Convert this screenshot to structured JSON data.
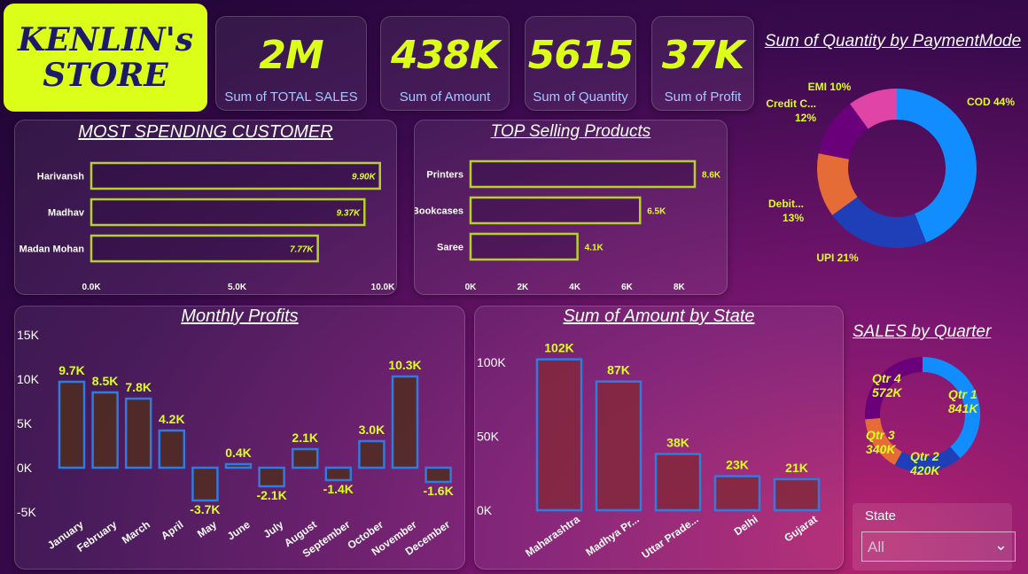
{
  "store": {
    "line1": "KENLIN's",
    "line2": "STORE"
  },
  "kpis": [
    {
      "value": "2M",
      "label": "Sum of TOTAL SALES"
    },
    {
      "value": "438K",
      "label": "Sum of Amount"
    },
    {
      "value": "5615",
      "label": "Sum of Quantity"
    },
    {
      "value": "37K",
      "label": "Sum of Profit"
    }
  ],
  "slicer": {
    "title": "State",
    "value": "All"
  },
  "colors": {
    "accent": "#dcff1a",
    "bar_outline": "#b7d12a",
    "blue": "#2f7be0"
  },
  "chart_data": [
    {
      "id": "most_spending_customer",
      "type": "bar",
      "orientation": "horizontal",
      "title": "MOST SPENDING CUSTOMER",
      "categories": [
        "Harivansh",
        "Madhav",
        "Madan Mohan"
      ],
      "values": [
        9900,
        9370,
        7770
      ],
      "data_labels": [
        "9.90K",
        "9.37K",
        "7.77K"
      ],
      "xlim": [
        0,
        10000
      ],
      "xticks": [
        "0.0K",
        "5.0K",
        "10.0K"
      ]
    },
    {
      "id": "top_selling_products",
      "type": "bar",
      "orientation": "horizontal",
      "title": "TOP Selling Products",
      "categories": [
        "Printers",
        "Bookcases",
        "Saree"
      ],
      "values": [
        8600,
        6500,
        4100
      ],
      "data_labels": [
        "8.6K",
        "6.5K",
        "4.1K"
      ],
      "xlim": [
        0,
        8600
      ],
      "xticks": [
        "0K",
        "2K",
        "4K",
        "6K",
        "8K"
      ]
    },
    {
      "id": "payment_mode",
      "type": "pie",
      "style": "donut",
      "title": "Sum of Quantity by PaymentMode",
      "categories": [
        "COD",
        "UPI",
        "Debit...",
        "Credit C...",
        "EMI"
      ],
      "values": [
        44,
        21,
        13,
        12,
        10
      ],
      "labels": [
        [
          "COD 44%"
        ],
        [
          "UPI 21%"
        ],
        [
          "Debit...",
          "13%"
        ],
        [
          "Credit C...",
          "12%"
        ],
        [
          "EMI 10%"
        ]
      ],
      "colors": [
        "#118dff",
        "#1f3fb8",
        "#e66c37",
        "#6b007b",
        "#e044a7"
      ]
    },
    {
      "id": "monthly_profits",
      "type": "bar",
      "title": "Monthly Profits",
      "categories": [
        "January",
        "February",
        "March",
        "April",
        "May",
        "June",
        "July",
        "August",
        "September",
        "October",
        "November",
        "December"
      ],
      "values": [
        9700,
        8500,
        7800,
        4200,
        -3700,
        400,
        -2100,
        2100,
        -1400,
        3000,
        10300,
        -1600
      ],
      "data_labels": [
        "9.7K",
        "8.5K",
        "7.8K",
        "4.2K",
        "-3.7K",
        "0.4K",
        "-2.1K",
        "2.1K",
        "-1.4K",
        "3.0K",
        "10.3K",
        "-1.6K"
      ],
      "ylim": [
        -5000,
        15000
      ],
      "yticks": [
        "15K",
        "10K",
        "5K",
        "0K",
        "-5K"
      ]
    },
    {
      "id": "amount_by_state",
      "type": "bar",
      "title": "Sum of Amount by State",
      "categories": [
        "Maharashtra",
        "Madhya Pr...",
        "Uttar Prade...",
        "Delhi",
        "Gujarat"
      ],
      "values": [
        102000,
        87000,
        38000,
        23000,
        21000
      ],
      "data_labels": [
        "102K",
        "87K",
        "38K",
        "23K",
        "21K"
      ],
      "ylim": [
        0,
        100000
      ],
      "yticks": [
        "100K",
        "50K",
        "0K"
      ]
    },
    {
      "id": "sales_by_quarter",
      "type": "pie",
      "style": "donut",
      "title": "SALES by Quarter",
      "categories": [
        "Qtr 1",
        "Qtr 2",
        "Qtr 3",
        "Qtr 4"
      ],
      "values": [
        841,
        420,
        340,
        572
      ],
      "labels": [
        [
          "Qtr 1",
          "841K"
        ],
        [
          "Qtr 2",
          "420K"
        ],
        [
          "Qtr 3",
          "340K"
        ],
        [
          "Qtr 4",
          "572K"
        ]
      ],
      "colors": [
        "#118dff",
        "#1f3fb8",
        "#e66c37",
        "#6b007b"
      ]
    }
  ]
}
